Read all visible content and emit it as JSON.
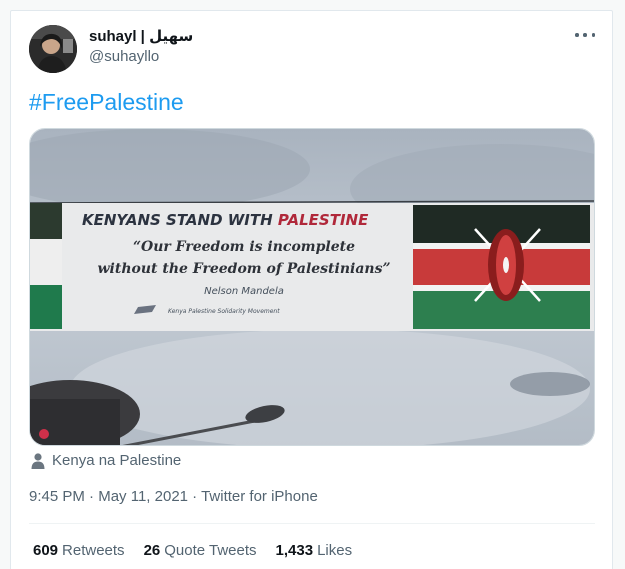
{
  "tweet": {
    "display_name": "suhayl | سهيل",
    "handle": "@suhayllo",
    "hashtag": "#FreePalestine",
    "banner": {
      "headline_part1": "KENYANS STAND WITH ",
      "headline_part2": "PALESTINE",
      "quote_line1": "“Our Freedom is incomplete",
      "quote_line2": "without the Freedom of Palestinians”",
      "attribution": "Nelson Mandela",
      "org": "Kenya Palestine Solidarity Movement"
    },
    "location": "Kenya na Palestine",
    "time": "9:45 PM",
    "separator": "·",
    "date": "May 11, 2021",
    "source": "Twitter for iPhone",
    "retweets_count": "609",
    "retweets_label": "Retweets",
    "quotes_count": "26",
    "quotes_label": "Quote Tweets",
    "likes_count": "1,433",
    "likes_label": "Likes"
  },
  "icons": {
    "more": "more-horizontal-icon",
    "location": "person-icon"
  },
  "colors": {
    "link": "#1d9bf0",
    "secondary_text": "#536471",
    "primary_text": "#0f1419"
  }
}
